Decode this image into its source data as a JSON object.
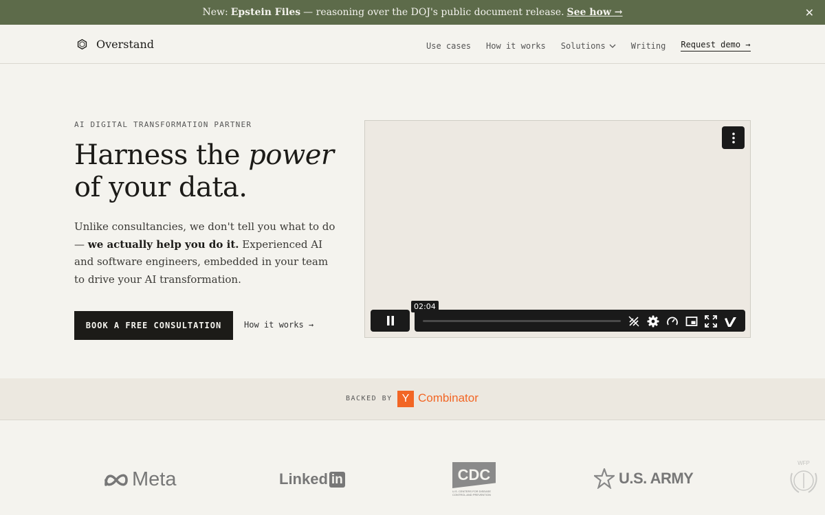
{
  "banner": {
    "prefix": "New:",
    "highlight": "Epstein Files",
    "text": "— reasoning over the DOJ's public document release.",
    "link": "See how →",
    "close": "✕"
  },
  "brand": {
    "name": "Overstand"
  },
  "nav": {
    "items": [
      "Use cases",
      "How it works",
      "Solutions",
      "Writing"
    ],
    "cta": "Request demo →"
  },
  "hero": {
    "eyebrow": "AI DIGITAL TRANSFORMATION PARTNER",
    "headline_a": "Harness the",
    "headline_em": "power",
    "headline_b": "of your data.",
    "sub_a": "Unlike consultancies, we don't tell you what to do —",
    "sub_strong": "we actually help you do it.",
    "sub_b": "Experienced AI and software engineers, embedded in your team to drive your AI transformation.",
    "primary_cta": "BOOK A FREE CONSULTATION",
    "secondary_cta": "How it works →"
  },
  "video": {
    "time": "02:04",
    "progress": 0.0
  },
  "backed": {
    "label": "BACKED BY",
    "yc_letter": "Y",
    "yc_name": "Combinator"
  },
  "logos": {
    "meta": "Meta",
    "linkedin_a": "Linked",
    "linkedin_b": "in",
    "cdc": "CDC",
    "cdc_sub": "U.S. CENTERS FOR DISEASE CONTROL AND PREVENTION",
    "army": "U.S. ARMY",
    "wfp": "WFP"
  },
  "colors": {
    "banner": "#5d6b4a",
    "ink": "#1c1b18",
    "yc": "#f26625",
    "bg": "#f4f3ee"
  }
}
